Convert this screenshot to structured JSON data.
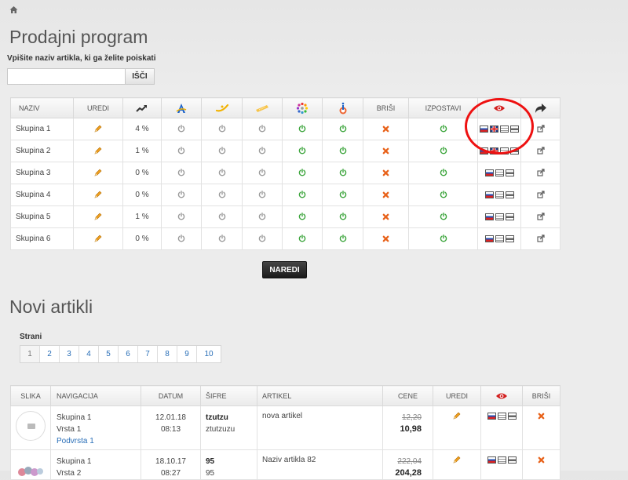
{
  "page": {
    "title": "Prodajni program",
    "section2_title": "Novi artikli"
  },
  "search": {
    "label": "Vpišite naziv artikla, ki ga želite poiskati",
    "value": "",
    "placeholder": "",
    "button": "IŠČI"
  },
  "program_table": {
    "headers": {
      "naziv": "NAZIV",
      "uredi": "UREDI",
      "brisi": "BRIŠI",
      "izpostavi": "IZPOSTAVI"
    },
    "header_icons": [
      "trend-icon",
      "brand-a-icon",
      "brand-swoosh-icon",
      "brand-ticket-icon",
      "brand-dots-icon",
      "brand-info-icon",
      "eye-icon",
      "share-arrow-icon"
    ],
    "rows": [
      {
        "name": "Skupina 1",
        "pct": "4 %",
        "flags": [
          "si",
          "gb",
          "doc",
          "print"
        ]
      },
      {
        "name": "Skupina 2",
        "pct": "1 %",
        "flags": [
          "si",
          "gb",
          "doc",
          "print"
        ]
      },
      {
        "name": "Skupina 3",
        "pct": "0 %",
        "flags": [
          "si",
          "doc",
          "print"
        ]
      },
      {
        "name": "Skupina 4",
        "pct": "0 %",
        "flags": [
          "si",
          "doc",
          "print"
        ]
      },
      {
        "name": "Skupina 5",
        "pct": "1 %",
        "flags": [
          "si",
          "doc",
          "print"
        ]
      },
      {
        "name": "Skupina 6",
        "pct": "0 %",
        "flags": [
          "si",
          "doc",
          "print"
        ]
      }
    ]
  },
  "naredi_button": "NAREDI",
  "pager": {
    "label": "Strani",
    "pages": [
      "1",
      "2",
      "3",
      "4",
      "5",
      "6",
      "7",
      "8",
      "9",
      "10"
    ],
    "active": "1"
  },
  "articles_table": {
    "headers": {
      "slika": "SLIKA",
      "navigacija": "NAVIGACIJA",
      "datum": "DATUM",
      "sifre": "ŠIFRE",
      "artikel": "ARTIKEL",
      "cene": "CENE",
      "uredi": "UREDI",
      "brisi": "BRIŠI"
    },
    "rows": [
      {
        "nav1": "Skupina 1",
        "nav2": "Vrsta 1",
        "nav3": "Podvrsta 1",
        "date": "12.01.18",
        "time": "08:13",
        "sifra1": "tzutzu",
        "sifra2": "ztutzuzu",
        "artikel": "nova artikel",
        "old_price": "12,20",
        "new_price": "10,98"
      },
      {
        "nav1": "Skupina 1",
        "nav2": "Vrsta 2",
        "nav3": "",
        "date": "18.10.17",
        "time": "08:27",
        "sifra1": "95",
        "sifra2": "95",
        "artikel": "Naziv artikla 82",
        "old_price": "222,04",
        "new_price": "204,28"
      }
    ]
  },
  "colors": {
    "green_power": "#3aa43a",
    "grey_power": "#9a9a9a",
    "red": "#d42020",
    "orange_x": "#e8621a",
    "link": "#2a6fb8"
  }
}
